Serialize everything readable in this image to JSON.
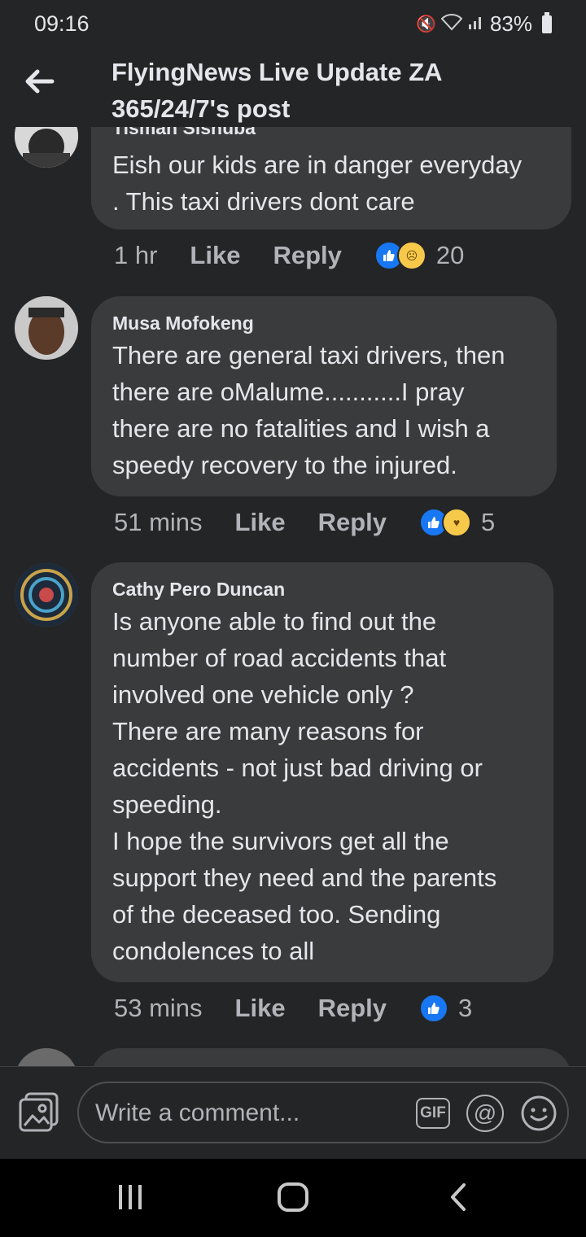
{
  "status_bar": {
    "time": "09:16",
    "battery": "83%"
  },
  "header": {
    "title_line1": "FlyingNews Live Update ZA",
    "title_line2": "365/24/7's post"
  },
  "comments": [
    {
      "author": "Tisman Sisnuba",
      "text": "Eish our kids are in danger everyday\n. This taxi drivers dont care",
      "time": "1 hr",
      "like_label": "Like",
      "reply_label": "Reply",
      "reactions": [
        "like",
        "sad"
      ],
      "reaction_count": "20"
    },
    {
      "author": "Musa Mofokeng",
      "text": "There are general taxi drivers, then\nthere are oMalume...........I pray\nthere are no fatalities  and I wish a\nspeedy recovery to the injured.",
      "time": "51 mins",
      "like_label": "Like",
      "reply_label": "Reply",
      "reactions": [
        "like",
        "care"
      ],
      "reaction_count": "5"
    },
    {
      "author": "Cathy Pero Duncan",
      "text": "Is anyone able to find out the\nnumber of road accidents that\ninvolved one vehicle only ?\nThere are many reasons for\naccidents - not just bad driving or\nspeeding.\nI hope the survivors get all the\nsupport they need and the parents\nof the deceased too. Sending\ncondolences to all",
      "time": "53 mins",
      "like_label": "Like",
      "reply_label": "Reply",
      "reactions": [
        "like"
      ],
      "reaction_count": "3"
    }
  ],
  "composer": {
    "placeholder": "Write a comment...",
    "gif_label": "GIF",
    "mention_label": "@"
  },
  "colors": {
    "background": "#242526",
    "bubble": "#3a3b3c",
    "like_blue": "#1877f2",
    "reaction_yellow": "#f7c94b"
  }
}
